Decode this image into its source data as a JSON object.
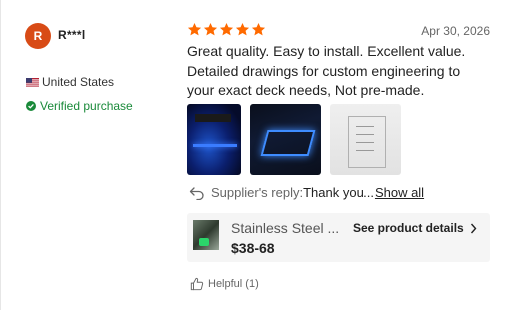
{
  "reviewer": {
    "avatar_letter": "R",
    "name": "R***l",
    "country": "United States",
    "verified_label": "Verified purchase"
  },
  "review": {
    "rating": 5,
    "date": "Apr 30, 2026",
    "text": "Great quality. Easy to install. Excellent value. Detailed drawings for custom engineering to your exact deck needs, Not pre-made."
  },
  "reply": {
    "label": "Supplier's reply:",
    "text": "Thank you",
    "ellipsis": "...",
    "show_all": "Show all"
  },
  "product": {
    "title": "Stainless Steel ...",
    "price": "$38-68",
    "see_details": "See product details"
  },
  "helpful": {
    "label": "Helpful (1)"
  },
  "colors": {
    "avatar_bg": "#d84b16",
    "star": "#ff6a00",
    "verified": "#1a8a3a"
  }
}
